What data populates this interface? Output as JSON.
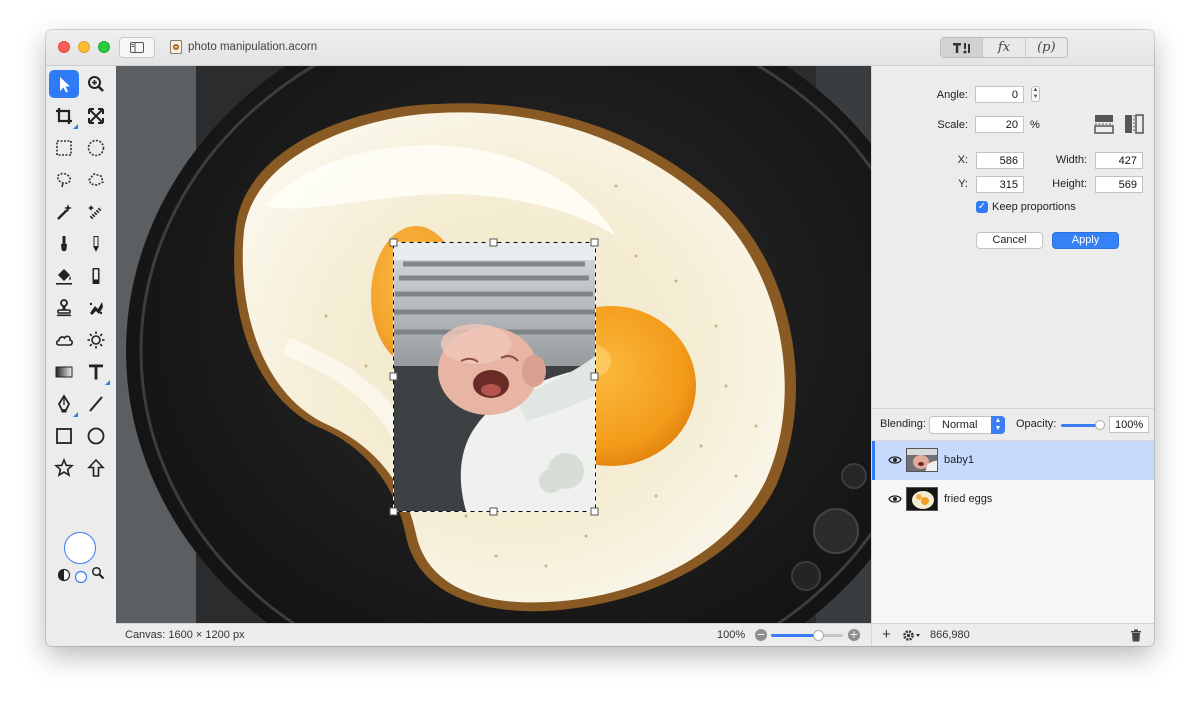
{
  "window": {
    "title": "photo manipulation.acorn"
  },
  "title_tools": {
    "tools": [
      {
        "label": "T!",
        "icon": "text-and-tools-icon"
      },
      {
        "label": "fx",
        "icon": "filters-icon"
      },
      {
        "label": "(p)",
        "icon": "plugins-icon"
      }
    ]
  },
  "toolbox": {
    "tools": [
      "move-arrow-icon",
      "zoom-icon",
      "crop-icon",
      "transform-icon",
      "rect-select-icon",
      "ellipse-select-icon",
      "lasso-icon",
      "polygon-lasso-icon",
      "magic-wand-icon",
      "magic-wand-alt-icon",
      "brush-icon",
      "pencil-icon",
      "paint-bucket-icon",
      "eraser-icon",
      "clone-stamp-icon",
      "retouch-icon",
      "cloud-shape-icon",
      "sun-icon",
      "gradient-icon",
      "text-tool-icon",
      "pen-icon",
      "line-icon",
      "rectangle-icon",
      "oval-icon",
      "star-icon",
      "arrow-up-icon"
    ],
    "active_tool": "move-arrow-icon"
  },
  "status": {
    "canvas_size": "Canvas: 1600 × 1200 px",
    "zoom": "100%",
    "zoom_level": 0.65
  },
  "transform": {
    "angle_label": "Angle:",
    "angle": "0",
    "scale_label": "Scale:",
    "scale": "20",
    "scale_unit": "%",
    "x_label": "X:",
    "x": "586",
    "y_label": "Y:",
    "y": "315",
    "width_label": "Width:",
    "width": "427",
    "height_label": "Height:",
    "height": "569",
    "keep_proportions_label": "Keep proportions",
    "keep_proportions": true,
    "cancel_label": "Cancel",
    "apply_label": "Apply"
  },
  "layers": {
    "blending_label": "Blending:",
    "blending": "Normal",
    "opacity_label": "Opacity:",
    "opacity": "100%",
    "items": [
      {
        "name": "baby1",
        "selected": true,
        "visible": true
      },
      {
        "name": "fried eggs",
        "selected": false,
        "visible": true
      }
    ],
    "footer_value": "866,980"
  },
  "colors": {
    "accent": "#2f7bf5",
    "egg_yolk": "#f4a01d",
    "egg_white": "#f4efd8",
    "pan": "#161616"
  }
}
